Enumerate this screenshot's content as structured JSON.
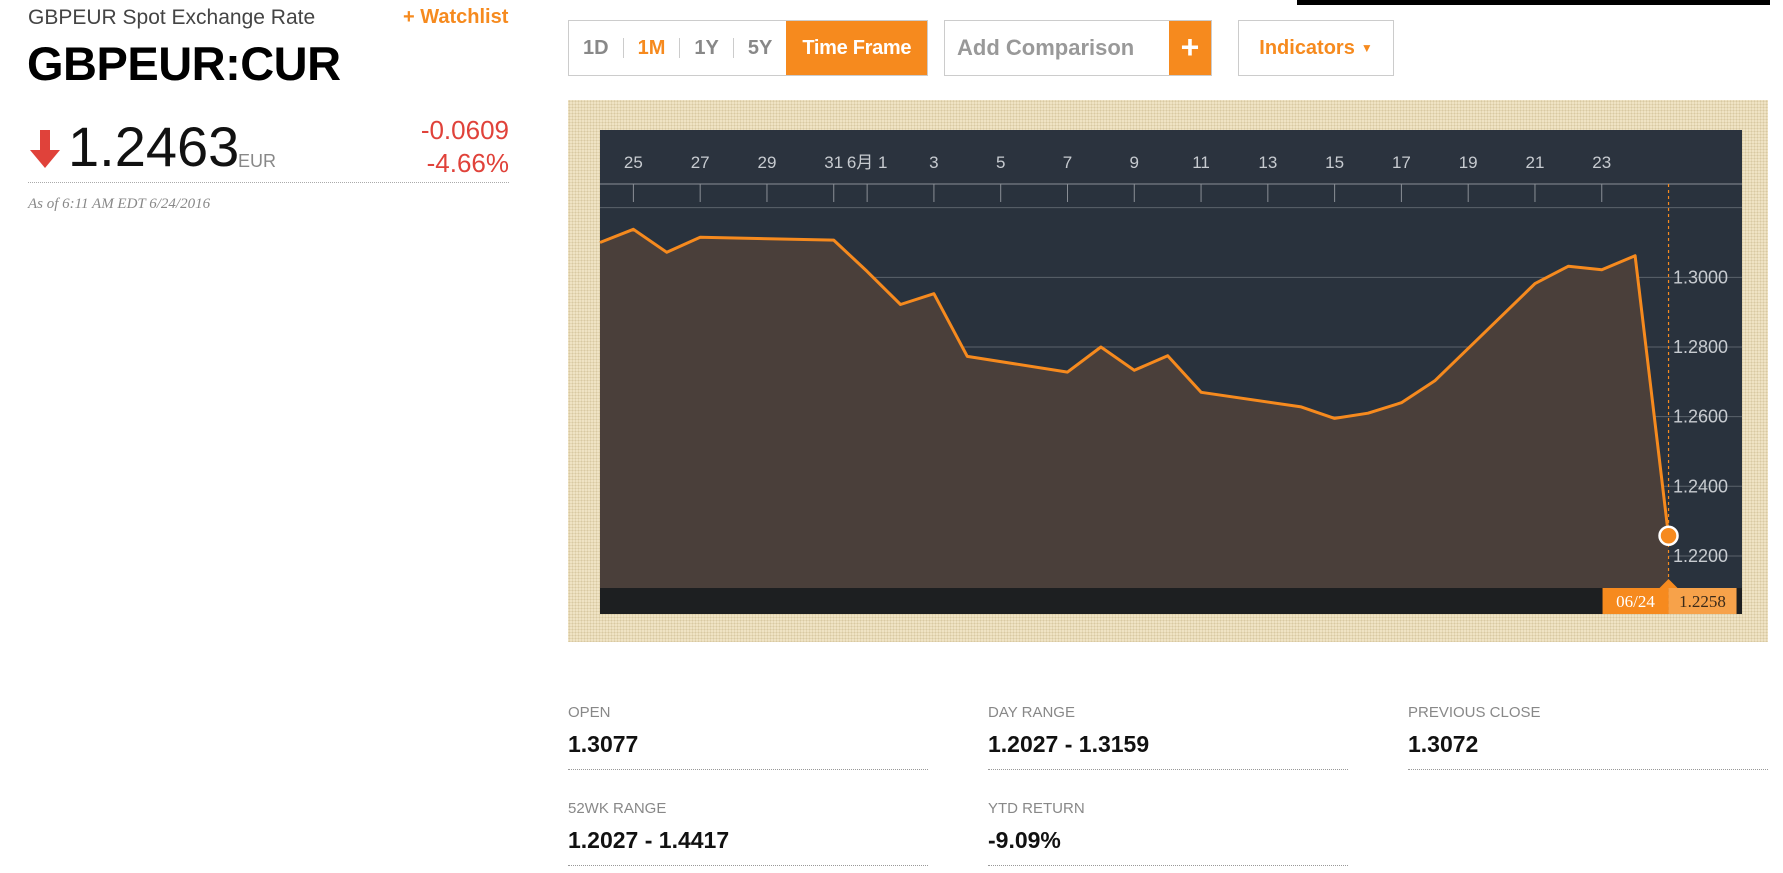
{
  "header": {
    "name": "GBPEUR Spot Exchange Rate",
    "watchlist_label": "+ Watchlist",
    "ticker": "GBPEUR:CUR",
    "price": "1.2463",
    "currency": "EUR",
    "change": "-0.0609",
    "change_pct": "-4.66%",
    "as_of": "As of 6:11 AM EDT 6/24/2016",
    "direction_icon": "down-arrow-icon"
  },
  "timeframe": {
    "buttons": [
      "1D",
      "1M",
      "1Y",
      "5Y"
    ],
    "selected": "1M",
    "main_label": "Time Frame"
  },
  "comparison": {
    "placeholder": "Add Comparison",
    "plus_label": "+"
  },
  "indicators": {
    "label": "Indicators",
    "caret": "▼"
  },
  "tooltip": {
    "date": "06/24",
    "value": "1.2258"
  },
  "stats": {
    "open": {
      "label": "OPEN",
      "value": "1.3077"
    },
    "day_range": {
      "label": "DAY RANGE",
      "value": "1.2027 - 1.3159"
    },
    "previous_close": {
      "label": "PREVIOUS CLOSE",
      "value": "1.3072"
    },
    "wk52_range": {
      "label": "52WK RANGE",
      "value": "1.2027 - 1.4417"
    },
    "ytd_return": {
      "label": "YTD RETURN",
      "value": "-9.09%"
    }
  },
  "colors": {
    "accent": "#f68a1e",
    "negative": "#e0423a",
    "plot_bg": "#29323d",
    "area": "#4a3f3a"
  },
  "chart_data": {
    "type": "area",
    "x_tick_labels": [
      "25",
      "27",
      "29",
      "31",
      "6月 1",
      "3",
      "5",
      "7",
      "9",
      "11",
      "13",
      "15",
      "17",
      "19",
      "21",
      "23"
    ],
    "x_tick_day": [
      0,
      2,
      4,
      6,
      7,
      9,
      11,
      13,
      15,
      17,
      19,
      21,
      23,
      25,
      27,
      29
    ],
    "y_tick_labels": [
      "1.3000",
      "1.2800",
      "1.2600",
      "1.2400",
      "1.2200"
    ],
    "y_ticks": [
      1.3,
      1.28,
      1.26,
      1.24,
      1.22
    ],
    "x_range": [
      -1,
      33.2
    ],
    "ylim": [
      1.2108,
      1.3268
    ],
    "series": [
      {
        "x": [
          -1,
          0,
          1,
          2,
          6,
          7,
          8,
          9,
          10,
          13,
          14,
          15,
          16,
          17,
          20,
          21,
          22,
          23,
          24,
          27,
          28,
          29,
          30,
          31
        ],
        "values": [
          1.31,
          1.3138,
          1.3072,
          1.3115,
          1.3107,
          1.3017,
          1.2922,
          1.2953,
          1.2773,
          1.2728,
          1.28,
          1.2733,
          1.2775,
          1.267,
          1.2628,
          1.2595,
          1.261,
          1.264,
          1.2703,
          1.2982,
          1.3032,
          1.3022,
          1.3062,
          1.2258
        ]
      }
    ],
    "grid": true,
    "legend": "none"
  }
}
